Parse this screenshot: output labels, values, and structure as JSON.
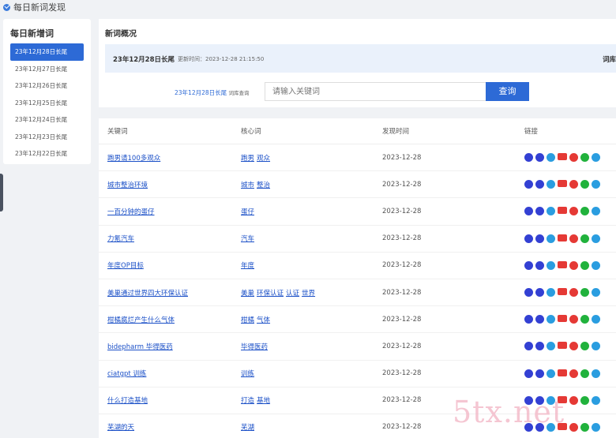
{
  "app": {
    "title": "每日新词发现"
  },
  "sidebar": {
    "title": "每日新增词",
    "items": [
      {
        "label": "23年12月28日长尾"
      },
      {
        "label": "23年12月27日长尾"
      },
      {
        "label": "23年12月26日长尾"
      },
      {
        "label": "23年12月25日长尾"
      },
      {
        "label": "23年12月24日长尾"
      },
      {
        "label": "23年12月23日长尾"
      },
      {
        "label": "23年12月22日长尾"
      }
    ]
  },
  "overview": {
    "title": "新词概况",
    "main_label": "23年12月28日长尾",
    "updated": "更新时间：2023-12-28 21:15:50",
    "right_label": "词库"
  },
  "query": {
    "label": "23年12月28日长尾",
    "sub_label": "词库查询",
    "placeholder": "请输入关键词",
    "button": "查询"
  },
  "table": {
    "headers": [
      "关键词",
      "核心词",
      "发现时间",
      "链接"
    ],
    "rows": [
      {
        "keyword": "跑男请100多观众",
        "core": [
          "跑男",
          "观众"
        ],
        "date": "2023-12-28"
      },
      {
        "keyword": "城市整治环境",
        "core": [
          "城市",
          "整治"
        ],
        "date": "2023-12-28"
      },
      {
        "keyword": "一百分钟的蛋仔",
        "core": [
          "蛋仔"
        ],
        "date": "2023-12-28"
      },
      {
        "keyword": "力氪汽车",
        "core": [
          "汽车"
        ],
        "date": "2023-12-28"
      },
      {
        "keyword": "年度OP目标",
        "core": [
          "年度"
        ],
        "date": "2023-12-28"
      },
      {
        "keyword": "美巢通过世界四大环保认证",
        "core": [
          "美巢",
          "环保认证",
          "认证",
          "世界"
        ],
        "date": "2023-12-28"
      },
      {
        "keyword": "柑橘腐烂产生什么气体",
        "core": [
          "柑橘",
          "气体"
        ],
        "date": "2023-12-28"
      },
      {
        "keyword": "bidepharm 毕得医药",
        "core": [
          "毕得医药"
        ],
        "date": "2023-12-28"
      },
      {
        "keyword": "ciatgpt 训练",
        "core": [
          "训练"
        ],
        "date": "2023-12-28"
      },
      {
        "keyword": "什么打造基地",
        "core": [
          "打造",
          "基地"
        ],
        "date": "2023-12-28"
      },
      {
        "keyword": "芜湖的天",
        "core": [
          "芜湖"
        ],
        "date": "2023-12-28"
      }
    ],
    "link_icons": [
      {
        "name": "baidu-icon",
        "glyph": ""
      },
      {
        "name": "sogou-icon",
        "glyph": ""
      },
      {
        "name": "so360-icon",
        "glyph": ""
      },
      {
        "name": "toutiao-icon",
        "glyph": ""
      },
      {
        "name": "weibo-icon",
        "glyph": ""
      },
      {
        "name": "wechat-icon",
        "glyph": ""
      },
      {
        "name": "zhihu-icon",
        "glyph": ""
      }
    ]
  },
  "watermark": "5tx.net",
  "colors": {
    "accent": "#2d6ad6",
    "link": "#1a4fc7"
  }
}
